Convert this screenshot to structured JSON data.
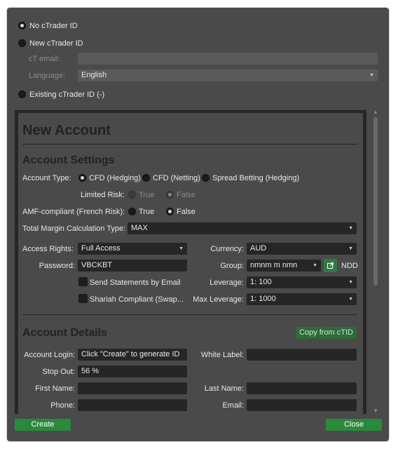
{
  "ctrader_options": {
    "no_ctrader_id": "No cTrader ID",
    "new_ctrader_id": "New cTrader ID",
    "ct_email_label": "cT email:",
    "ct_email_value": "",
    "language_label": "Language:",
    "language_value": "English",
    "existing_ctrader_id": "Existing cTrader ID (-)",
    "selected": "no_ctrader_id"
  },
  "new_account": {
    "title": "New Account",
    "account_settings": {
      "heading": "Account Settings",
      "account_type_label": "Account Type:",
      "account_types": [
        "CFD (Hedging)",
        "CFD (Netting)",
        "Spread Betting (Hedging)"
      ],
      "account_type_selected": "CFD (Hedging)",
      "limited_risk_label": "Limited Risk:",
      "limited_risk_true": "True",
      "limited_risk_false": "False",
      "amf_label": "AMF-compliant (French Risk):",
      "amf_true": "True",
      "amf_false": "False",
      "margin_calc_label": "Total Margin Calculation Type:",
      "margin_calc_value": "MAX",
      "access_rights_label": "Access Rights:",
      "access_rights_value": "Full Access",
      "currency_label": "Currency:",
      "currency_value": "AUD",
      "password_label": "Password:",
      "password_value": "VBCKBT",
      "group_label": "Group:",
      "group_value": "nmnm m nmn",
      "ndd_label": "NDD",
      "send_statements_label": "Send Statements by Email",
      "leverage_label": "Leverage:",
      "leverage_value": "1: 100",
      "shariah_label": "Shariah Compliant (Swap...",
      "max_leverage_label": "Max Leverage:",
      "max_leverage_value": "1: 1000"
    },
    "account_details": {
      "heading": "Account Details",
      "copy_button": "Copy from cTID",
      "account_login_label": "Account Login:",
      "account_login_value": "Click \"Create\" to generate ID",
      "white_label_label": "White Label:",
      "white_label_value": "",
      "stop_out_label": "Stop Out:",
      "stop_out_value": "56 %",
      "first_name_label": "First Name:",
      "first_name_value": "",
      "last_name_label": "Last Name:",
      "last_name_value": "",
      "phone_label": "Phone:",
      "phone_value": "",
      "email_label": "Email:",
      "email_value": ""
    }
  },
  "footer": {
    "create_button": "Create",
    "close_button": "Close"
  }
}
